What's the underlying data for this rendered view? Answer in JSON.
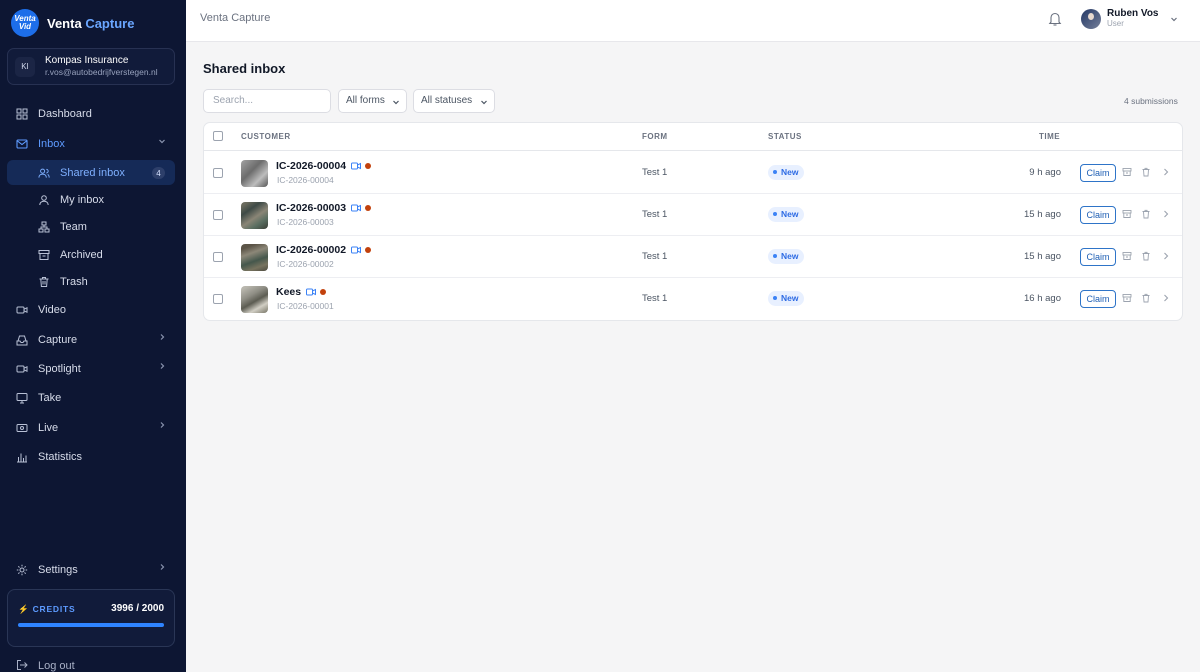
{
  "brand": {
    "logo_text": "Venta Vid",
    "name_part1": "Venta",
    "name_part2": "Capture",
    "accent": "#1d6ee9"
  },
  "org": {
    "badge": "KI",
    "name": "Kompas Insurance",
    "email": "r.vos@autobedrijfverstegen.nl"
  },
  "nav": {
    "dashboard": "Dashboard",
    "inbox": "Inbox",
    "shared_inbox": "Shared inbox",
    "shared_inbox_count": "4",
    "my_inbox": "My inbox",
    "team": "Team",
    "archived": "Archived",
    "trash": "Trash",
    "video": "Video",
    "capture": "Capture",
    "spotlight": "Spotlight",
    "take": "Take",
    "live": "Live",
    "statistics": "Statistics",
    "settings": "Settings",
    "logout": "Log out"
  },
  "credits": {
    "label": "CREDITS",
    "value": "3996 / 2000",
    "fill_fraction": 1.0
  },
  "topbar": {
    "title": "Venta Capture",
    "user_name": "Ruben Vos",
    "user_role": "User"
  },
  "page": {
    "title": "Shared inbox",
    "search_placeholder": "Search...",
    "filter_forms": "All forms",
    "filter_statuses": "All statuses",
    "count_text": "4 submissions"
  },
  "table": {
    "headers": {
      "customer": "CUSTOMER",
      "form": "FORM",
      "status": "STATUS",
      "time": "TIME"
    },
    "rows": [
      {
        "name": "IC-2026-00004",
        "id": "IC-2026-00004",
        "form": "Test 1",
        "status": "New",
        "time": "9 h ago",
        "action": "Claim",
        "video": true
      },
      {
        "name": "IC-2026-00003",
        "id": "IC-2026-00003",
        "form": "Test 1",
        "status": "New",
        "time": "15 h ago",
        "action": "Claim",
        "video": true
      },
      {
        "name": "IC-2026-00002",
        "id": "IC-2026-00002",
        "form": "Test 1",
        "status": "New",
        "time": "15 h ago",
        "action": "Claim",
        "video": true
      },
      {
        "name": "Kees",
        "id": "IC-2026-00001",
        "form": "Test 1",
        "status": "New",
        "time": "16 h ago",
        "action": "Claim",
        "video": true
      }
    ]
  },
  "colors": {
    "sidebar": "#0d1633",
    "primary": "#2d6be4",
    "status_new_bg": "#e8f0ff",
    "dot": "#c2410c"
  }
}
